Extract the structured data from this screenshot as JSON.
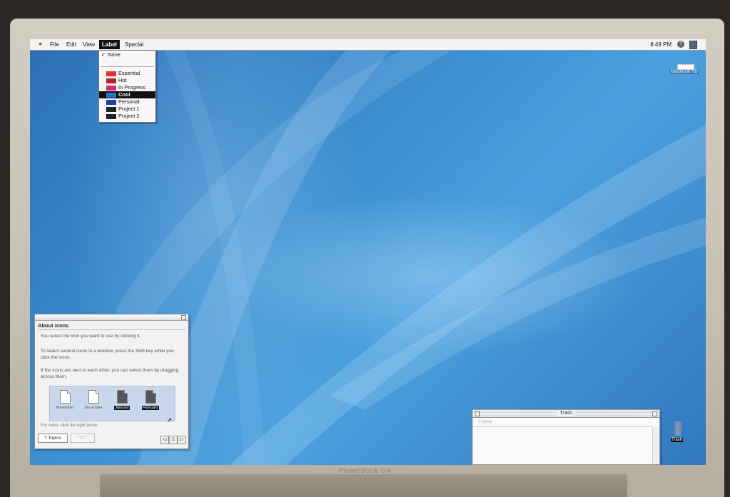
{
  "menubar": {
    "apple": "",
    "file": "File",
    "edit": "Edit",
    "view": "View",
    "label": "Label",
    "special": "Special",
    "clock": "8:49 PM"
  },
  "label_menu": {
    "items": [
      {
        "text": "None",
        "checked": true
      },
      {
        "text": "Essential",
        "color": "#e0322a"
      },
      {
        "text": "Hot",
        "color": "#b8222c"
      },
      {
        "text": "In Progress",
        "color": "#d0306a"
      },
      {
        "text": "Cool",
        "color": "#2a72c8",
        "selected": true
      },
      {
        "text": "Personal",
        "color": "#1c3ea8"
      },
      {
        "text": "Project 1",
        "color": "#222222"
      },
      {
        "text": "Project 2",
        "color": "#222222"
      }
    ]
  },
  "desktop": {
    "hd_label": "Macintosh HD",
    "trash_label": "Trash"
  },
  "about_window": {
    "title": "About icons",
    "p1": "You select the icon you want to use by clicking it.",
    "p2": "To select several icons in a window, press the Shift key while you click the icons.",
    "p3": "If the icons are next to each other, you can select them by dragging across them.",
    "icons": [
      {
        "name": "November",
        "selected": false
      },
      {
        "name": "December",
        "selected": false
      },
      {
        "name": "January",
        "selected": true
      },
      {
        "name": "February",
        "selected": true
      }
    ],
    "more": "For more, click the right arrow.",
    "topics": "Topics",
    "huh": "Huh?",
    "page": "2",
    "prev": "◁",
    "next": "▷"
  },
  "trash_window": {
    "title": "Trash",
    "info": "0 items"
  },
  "device": {
    "brand": "PowerBook G4"
  }
}
